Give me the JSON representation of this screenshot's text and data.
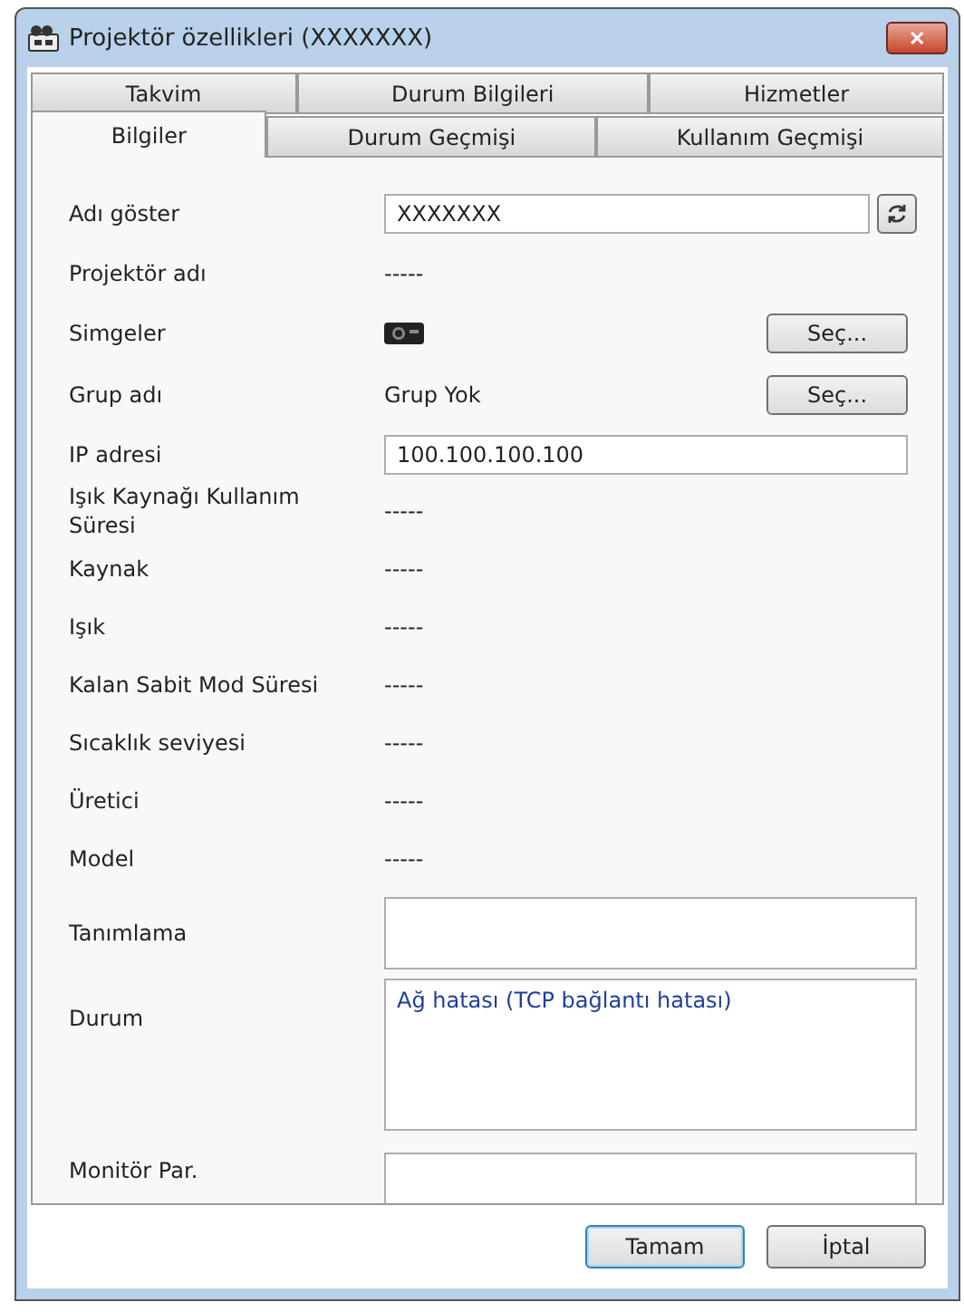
{
  "window": {
    "title": "Projektör özellikleri (XXXXXXX)",
    "close": "✕"
  },
  "tab_rows": [
    {
      "tabs": [
        {
          "label": "Takvim",
          "selected": false
        },
        {
          "label": "Durum Bilgileri",
          "selected": false
        },
        {
          "label": "Hizmetler",
          "selected": false
        }
      ]
    },
    {
      "tabs": [
        {
          "label": "Bilgiler",
          "selected": true
        },
        {
          "label": "Durum Geçmişi",
          "selected": false
        },
        {
          "label": "Kullanım Geçmişi",
          "selected": false
        }
      ]
    }
  ],
  "fields": [
    {
      "kind": "refresh_input",
      "label": "Adı göster",
      "value": "XXXXXXX"
    },
    {
      "kind": "text",
      "label": "Projektör adı",
      "value": "-----"
    },
    {
      "kind": "icon_choice",
      "label": "Simgeler",
      "button": "Seç..."
    },
    {
      "kind": "text_choice",
      "label": "Grup adı",
      "value": "Grup Yok",
      "button": "Seç..."
    },
    {
      "kind": "input",
      "label": "IP adresi",
      "value": "100.100.100.100"
    },
    {
      "kind": "text",
      "label": "Işık Kaynağı Kullanım Süresi",
      "value": "-----"
    },
    {
      "kind": "text",
      "label": "Kaynak",
      "value": "-----"
    },
    {
      "kind": "text",
      "label": "Işık",
      "value": "-----"
    },
    {
      "kind": "text",
      "label": "Kalan Sabit Mod Süresi",
      "value": "-----"
    },
    {
      "kind": "text",
      "label": "Sıcaklık seviyesi",
      "value": "-----"
    },
    {
      "kind": "text",
      "label": "Üretici",
      "value": "-----"
    },
    {
      "kind": "text",
      "label": "Model",
      "value": "-----"
    },
    {
      "kind": "memo",
      "label": "Tanımlama"
    },
    {
      "kind": "status",
      "label": "Durum",
      "value": "Ağ hatası (TCP bağlantı hatası)"
    },
    {
      "kind": "cut_input",
      "label": "Monitör Par."
    }
  ],
  "buttons": [
    {
      "label": "Tamam",
      "default": true
    },
    {
      "label": "İptal",
      "default": false
    }
  ]
}
